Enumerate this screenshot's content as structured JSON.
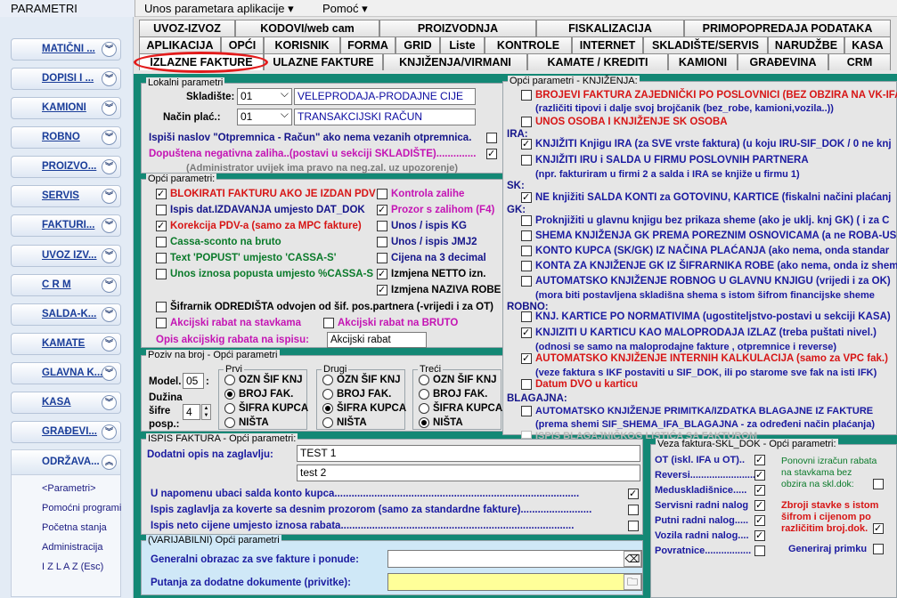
{
  "menubar": {
    "title": "PARAMETRI",
    "unos": "Unos parametara aplikacije",
    "pomoc": "Pomoć"
  },
  "sidebar": {
    "items": [
      "MATIČNI ...",
      "DOPISI I ...",
      "KAMIONI",
      "ROBNO",
      "PROIZVO...",
      "SERVIS",
      "FAKTURI...",
      "UVOZ IZV...",
      "C R M",
      "SALDA-K...",
      "KAMATE",
      "GLAVNA K...",
      "KASA",
      "GRAĐEVI..."
    ],
    "panel": {
      "title": "ODRŽAVA...",
      "links": [
        "<Parametri>",
        "Pomoćni programi",
        "Početna stanja",
        "Administracija",
        "I Z L A Z (Esc)"
      ]
    }
  },
  "tabs": {
    "row1": [
      "UVOZ-IZVOZ",
      "KODOVI/web cam",
      "PROIZVODNJA",
      "FISKALIZACIJA",
      "PRIMOPOPREDAJA PODATAKA"
    ],
    "row2": [
      "APLIKACIJA",
      "OPĆI",
      "KORISNIK",
      "FORMA",
      "GRID",
      "Liste",
      "KONTROLE",
      "INTERNET",
      "SKLADIŠTE/SERVIS",
      "NARUDŽBE",
      "KASA"
    ],
    "row3": [
      "IZLAZNE FAKTURE",
      "ULAZNE FAKTURE",
      "KNJIŽENJA/VIRMANI",
      "KAMATE / KREDITI",
      "KAMIONI",
      "GRAĐEVINA",
      "CRM"
    ]
  },
  "lokalni": {
    "title": "Lokalni parametri",
    "skladiste_label": "Skladište:",
    "skladiste_code": "01",
    "skladiste_name": "VELEPRODAJA-PRODAJNE CIJE",
    "nacin_label": "Način plać.:",
    "nacin_code": "01",
    "nacin_name": "TRANSAKCIJSKI RAČUN",
    "ispisi": "Ispiši naslov \"Otpremnica - Račun\" ako nema vezanih otpremnica.",
    "dopustena": "Dopuštena negativna zaliha..(postavi u sekciji SKLADIŠTE)..............",
    "admin_note": "(Administrator uvijek ima pravo na neg.zal. uz upozorenje)"
  },
  "opci": {
    "title": "Opći parametri:",
    "left": [
      "BLOKIRATI FAKTURU AKO JE IZDAN PDV",
      "Ispis dat.IZDAVANJA umjesto DAT_DOK",
      "Korekcija PDV-a (samo za MPC fakture)",
      "Cassa-sconto na bruto",
      "Text 'POPUST' umjesto 'CASSA-S'",
      "Unos iznosa popusta umjesto %CASSA-S"
    ],
    "right": [
      "Kontrola zalihe",
      "Prozor s zalihom  (F4)",
      "Unos / ispis KG",
      "Unos / ispis JMJ2",
      "Cijena na 3 decimal",
      "Izmjena NETTO izn.",
      "Izmjena NAZIVA ROBE"
    ],
    "sifrarnik": "Šifrarnik ODREDIŠTA odvojen od šif. pos.partnera (-vrijedi i za OT)",
    "akc_stavk": "Akcijski rabat na stavkama",
    "akc_bruto": "Akcijski rabat na BRUTO",
    "opis_label": "Opis akcijskig rabata na ispisu:",
    "opis_value": "Akcijski rabat"
  },
  "poziv": {
    "title": "Poziv na broj - Opći parametri",
    "model_label": "Model.",
    "model_value": "05",
    "duzina_label": "Dužina",
    "sifre_label": "šifre",
    "posp_label": "posp.:",
    "posp_value": "4",
    "groups": [
      {
        "title": "Prvi",
        "options": [
          "OZN ŠIF KNJ",
          "BROJ FAK.",
          "ŠIFRA KUPCA",
          "NIŠTA"
        ]
      },
      {
        "title": "Drugi",
        "options": [
          "OZN ŠIF KNJ",
          "BROJ FAK.",
          "ŠIFRA KUPCA",
          "NIŠTA"
        ]
      },
      {
        "title": "Treći",
        "options": [
          "OZN ŠIF KNJ",
          "BROJ FAK.",
          "ŠIFRA KUPCA",
          "NIŠTA"
        ]
      }
    ]
  },
  "ispis": {
    "title": "ISPIS FAKTURA - Opći parametri:",
    "dodatni_label": "Dodatni opis na zaglavlju:",
    "line1": "TEST 1",
    "line2": "test 2",
    "chk": [
      "U napomenu ubaci salda konto kupca......................................................................................",
      "Ispis zaglavlja za koverte sa desnim prozorom (samo za standardne fakture).........................",
      "Ispis neto cijene umjesto iznosa rabata.................................................................................."
    ]
  },
  "varijabilni": {
    "title": "(VARIJABILNI) Opći parametri",
    "opca": "Generalni obrazac za sve fakture i ponude:",
    "putanja": "Putanja za dodatne dokumente (privitke):"
  },
  "knjizenja": {
    "title": "Opći parametri - KNJIŽENJA:",
    "t1": "BROJEVI FAKTURA ZAJEDNIČKI PO POSLOVNICI (BEZ OBZIRA NA VK-IFA)",
    "t1n": "(različiti tipovi i dalje svoj brojčanik (bez_robe, kamioni,vozila..))",
    "t2": "UNOS OSOBA I KNJIŽENJE SK OSOBA",
    "ira": "IRA:",
    "t3": "KNJIŽITI Knjigu IRA (za SVE vrste faktura) (u koju IRU-SIF_DOK / 0 ne knj",
    "t4": "KNJIŽITI  IRU i SALDA U FIRMU POSLOVNIH PARTNERA",
    "t4n": "(npr. fakturiram u firmi 2 a salda i IRA se knjiže u firmu 1)",
    "sk": "SK:",
    "t5": "NE knjižiti SALDA KONTI  za GOTOVINU, KARTICE (fiskalni načini plaćanj",
    "gk": "GK:",
    "t6": "Proknjižiti u glavnu knjigu bez prikaza sheme (ako je uklj. knj GK) ( i za C",
    "t7": "SHEMA KNJIŽENJA GK PREMA POREZNIM OSNOVICAMA (a ne ROBA-US",
    "t8": "KONTO KUPCA (SK/GK) IZ NAČINA PLAĆANJA (ako nema, onda standar",
    "t9": "KONTA ZA KNJIŽENJE GK IZ ŠIFRARNIKA ROBE (ako nema, onda iz shem",
    "t10": "AUTOMATSKO KNJIŽENJE ROBNOG U GLAVNU KNJIGU (vrijedi i za OK)",
    "t10n": "(mora biti postavljena skladišna shema s istom šifrom financijske sheme",
    "robno": "ROBNO:",
    "t11": "KNJ. KARTICE PO NORMATIVIMA (ugostiteljstvo-postavi u sekciji KASA)",
    "t12": "KNJIZITI U KARTICU KAO MALOPRODAJA IZLAZ (treba puštati nivel.)",
    "t12n": "(odnosi se samo na  maloprodajne fakture , otpremnice i reverse)",
    "t13": "AUTOMATSKO KNJIŽENJE INTERNIH KALKULACIJA (samo za VPC fak.)",
    "t13n": "(veze faktura s IKF postaviti u SIF_DOK, ili po starome sve fak na isti IFK)",
    "t14": "Datum DVO u karticu",
    "blag": "BLAGAJNA:",
    "t15": "AUTOMATSKO KNJIŽENJE PRIMITKA/IZDATKA BLAGAJNE IZ FAKTURE",
    "t15n": "(prema shemi SIF_SHEMA_IFA_BLAGAJNA - za određeni način plaćanja)",
    "t16": "ISPIS BLAGAJNIČKOG LISTIĆA SA FAKTUROM"
  },
  "veza": {
    "title": "Veza faktura-SKL_DOK - Opći parametri:",
    "items": [
      "OT  (iskl. IFA u OT)..",
      "Reversi........................",
      "Meduskladišnice.....",
      "Servisni radni nalog",
      "Putni radni nalog.....",
      "Vozila radni nalog....",
      "Povratnice................."
    ],
    "ponovni": "Ponovni izračun rabata na stavkama bez obzira na skl.dok:",
    "zbroji": "Zbroji stavke s istom šifrom i cijenom po različitim broj.dok.",
    "generaj": "Generiraj primku"
  }
}
